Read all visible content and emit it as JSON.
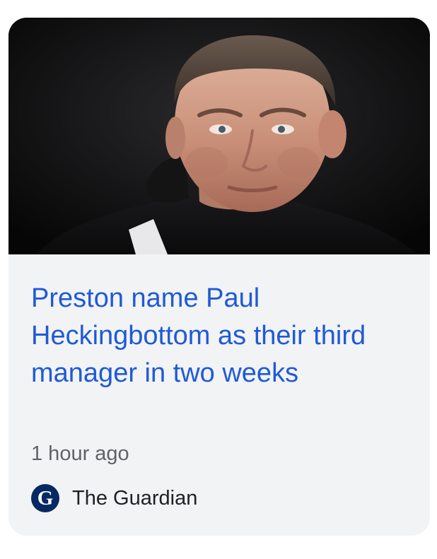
{
  "article": {
    "image_alt": "Paul Heckingbottom portrait",
    "headline": "Preston name Paul Heckingbottom as their third manager in two weeks",
    "time": "1 hour ago",
    "source": {
      "logo_letter": "G",
      "name": "The Guardian"
    }
  },
  "colors": {
    "headline": "#1f5ad6",
    "card_background": "#f2f3f5",
    "meta_text": "#5f6368",
    "guardian_logo": "#052962"
  },
  "icons": {
    "source_logo": "guardian-logo-icon"
  }
}
